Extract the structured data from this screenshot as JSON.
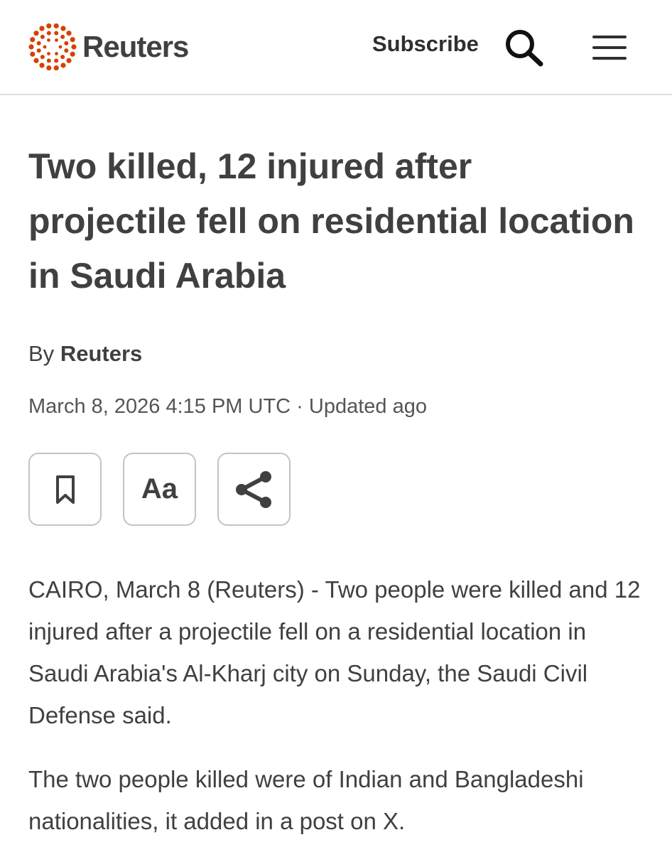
{
  "header": {
    "brand": "Reuters",
    "brand_color": "#d64000",
    "subscribe_label": "Subscribe",
    "search_icon": "search-icon",
    "menu_icon": "hamburger-menu-icon"
  },
  "article": {
    "headline": "Two killed, 12 injured after projectile fell on residential location in Saudi Arabia",
    "byline_prefix": "By",
    "byline_author": "Reuters",
    "dateline": "March 8, 2026 4:15 PM UTC · Updated ago",
    "tools": [
      {
        "name": "bookmark",
        "icon": "bookmark-icon"
      },
      {
        "name": "text-size",
        "label": "Aa"
      },
      {
        "name": "share",
        "icon": "share-icon"
      }
    ],
    "paragraphs": [
      "CAIRO, March 8 (Reuters) - Two people were killed and 12 injured after a projectile fell on a residential location in Saudi Arabia's Al-Kharj city on Sunday, the Saudi Civil Defense said.",
      "The two people killed were of Indian and Bangladeshi nationalities, it added in a post on X."
    ]
  }
}
